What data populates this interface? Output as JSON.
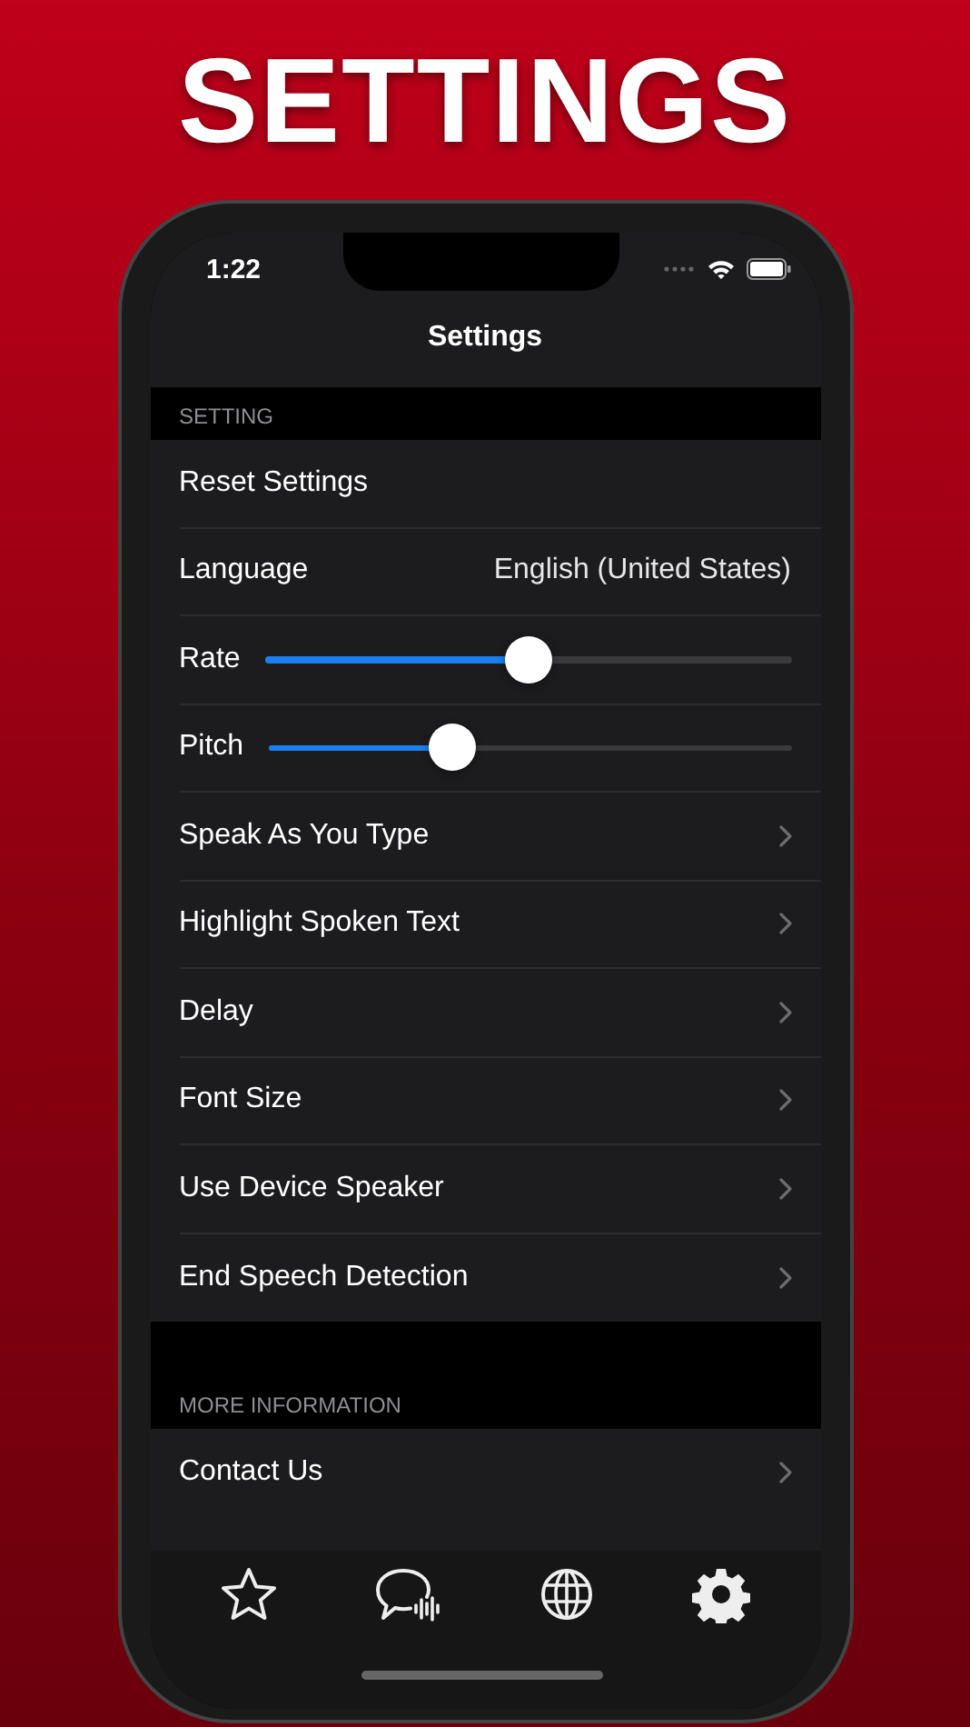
{
  "headline": "SETTINGS",
  "status_bar": {
    "time": "1:22"
  },
  "nav": {
    "title": "Settings"
  },
  "sections": [
    {
      "header": "SETTING",
      "rows": [
        {
          "kind": "plain",
          "label": "Reset Settings"
        },
        {
          "kind": "value",
          "label": "Language",
          "value": "English (United States)"
        },
        {
          "kind": "slider",
          "label": "Rate",
          "level": 0.5
        },
        {
          "kind": "slider",
          "label": "Pitch",
          "level": 0.35
        },
        {
          "kind": "link",
          "label": "Speak As You Type"
        },
        {
          "kind": "link",
          "label": "Highlight Spoken Text"
        },
        {
          "kind": "link",
          "label": "Delay"
        },
        {
          "kind": "link",
          "label": "Font Size"
        },
        {
          "kind": "link",
          "label": "Use Device Speaker"
        },
        {
          "kind": "link",
          "label": "End Speech Detection"
        }
      ]
    },
    {
      "header": "MORE INFORMATION",
      "rows": [
        {
          "kind": "link",
          "label": "Contact Us"
        }
      ]
    }
  ]
}
